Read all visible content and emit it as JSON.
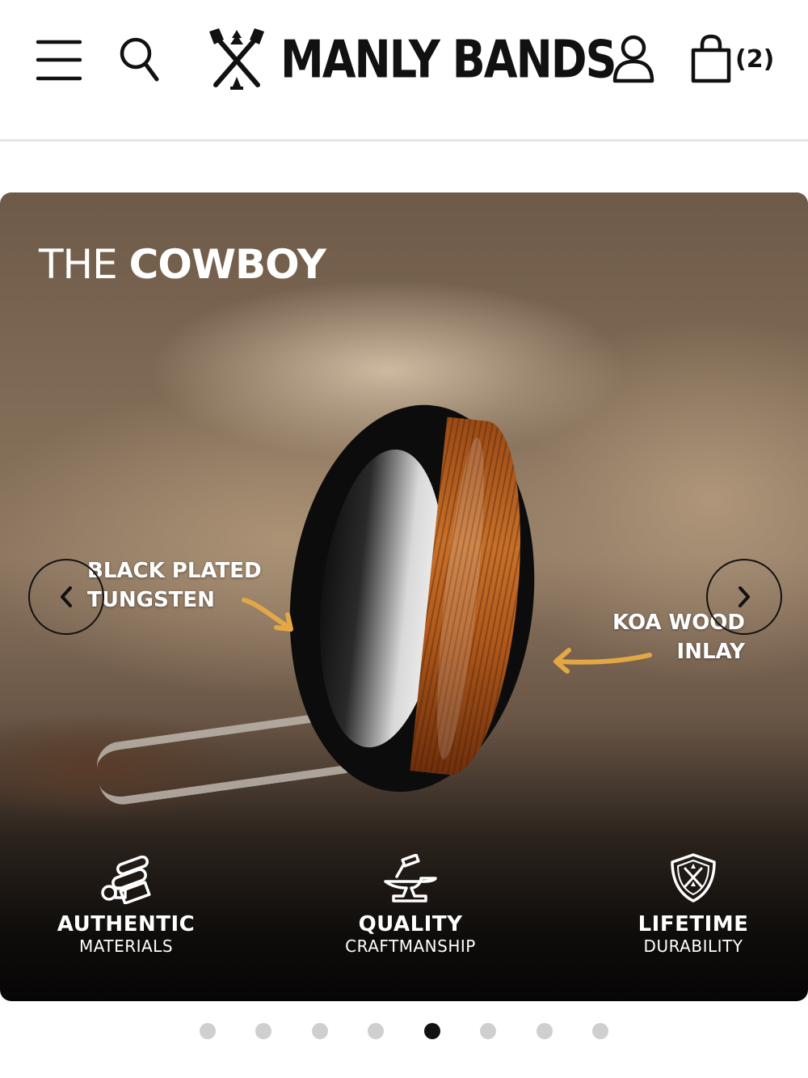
{
  "header": {
    "logo_text": "MANLY BANDS",
    "cart_count": "(2)"
  },
  "hero": {
    "title_light": "THE ",
    "title_bold": "COWBOY",
    "callout_left": [
      "BLACK PLATED",
      "TUNGSTEN"
    ],
    "callout_right": [
      "KOA WOOD",
      "INLAY"
    ],
    "arrow_color": "#e3a845"
  },
  "features": [
    {
      "title": "AUTHENTIC",
      "subtitle": "MATERIALS",
      "icon": "materials-icon"
    },
    {
      "title": "QUALITY",
      "subtitle": "CRAFTMANSHIP",
      "icon": "anvil-icon"
    },
    {
      "title": "LIFETIME",
      "subtitle": "DURABILITY",
      "icon": "shield-icon"
    }
  ],
  "carousel": {
    "total_slides": 8,
    "active_index": 4
  }
}
